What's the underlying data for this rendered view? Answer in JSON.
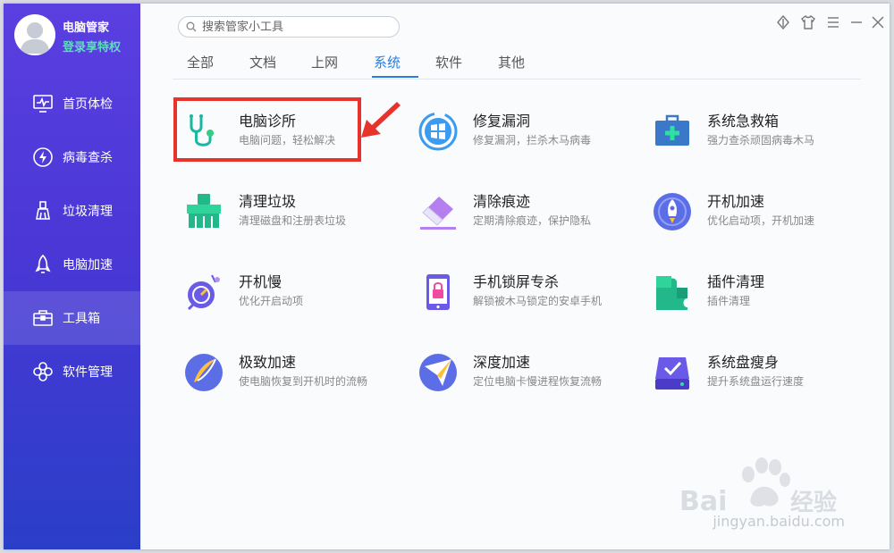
{
  "user": {
    "name": "电脑管家",
    "subtitle": "登录享特权"
  },
  "sidebar": {
    "items": [
      {
        "label": "首页体检",
        "icon": "monitor-pulse-icon"
      },
      {
        "label": "病毒查杀",
        "icon": "bolt-circle-icon"
      },
      {
        "label": "垃圾清理",
        "icon": "broom-icon"
      },
      {
        "label": "电脑加速",
        "icon": "rocket-icon"
      },
      {
        "label": "工具箱",
        "icon": "toolbox-icon",
        "active": true
      },
      {
        "label": "软件管理",
        "icon": "app-flower-icon"
      }
    ]
  },
  "search": {
    "placeholder": "搜索管家小工具"
  },
  "tabs": [
    {
      "label": "全部"
    },
    {
      "label": "文档"
    },
    {
      "label": "上网"
    },
    {
      "label": "系统",
      "active": true
    },
    {
      "label": "软件"
    },
    {
      "label": "其他"
    }
  ],
  "tools": [
    {
      "title": "电脑诊所",
      "desc": "电脑问题，轻松解决",
      "icon": "stethoscope-icon"
    },
    {
      "title": "修复漏洞",
      "desc": "修复漏洞，拦杀木马病毒",
      "icon": "windows-shield-icon"
    },
    {
      "title": "系统急救箱",
      "desc": "强力查杀顽固病毒木马",
      "icon": "first-aid-kit-icon"
    },
    {
      "title": "清理垃圾",
      "desc": "清理磁盘和注册表垃圾",
      "icon": "broom-icon"
    },
    {
      "title": "清除痕迹",
      "desc": "定期清除痕迹，保护隐私",
      "icon": "eraser-icon"
    },
    {
      "title": "开机加速",
      "desc": "优化启动项，开机加速",
      "icon": "rocket-icon"
    },
    {
      "title": "开机慢",
      "desc": "优化开启动项",
      "icon": "slow-boot-icon"
    },
    {
      "title": "手机锁屏专杀",
      "desc": "解锁被木马锁定的安卓手机",
      "icon": "phone-lock-icon"
    },
    {
      "title": "插件清理",
      "desc": "插件清理",
      "icon": "puzzle-icon"
    },
    {
      "title": "极致加速",
      "desc": "使电脑恢复到开机时的流畅",
      "icon": "feather-speed-icon"
    },
    {
      "title": "深度加速",
      "desc": "定位电脑卡慢进程恢复流畅",
      "icon": "paper-plane-icon"
    },
    {
      "title": "系统盘瘦身",
      "desc": "提升系统盘运行速度",
      "icon": "disk-check-icon"
    }
  ],
  "watermark": {
    "text": "jingyan.baidu.com"
  },
  "colors": {
    "accent": "#2a7de1",
    "highlight": "#e8332d",
    "sidebar": "#4a37d6"
  }
}
